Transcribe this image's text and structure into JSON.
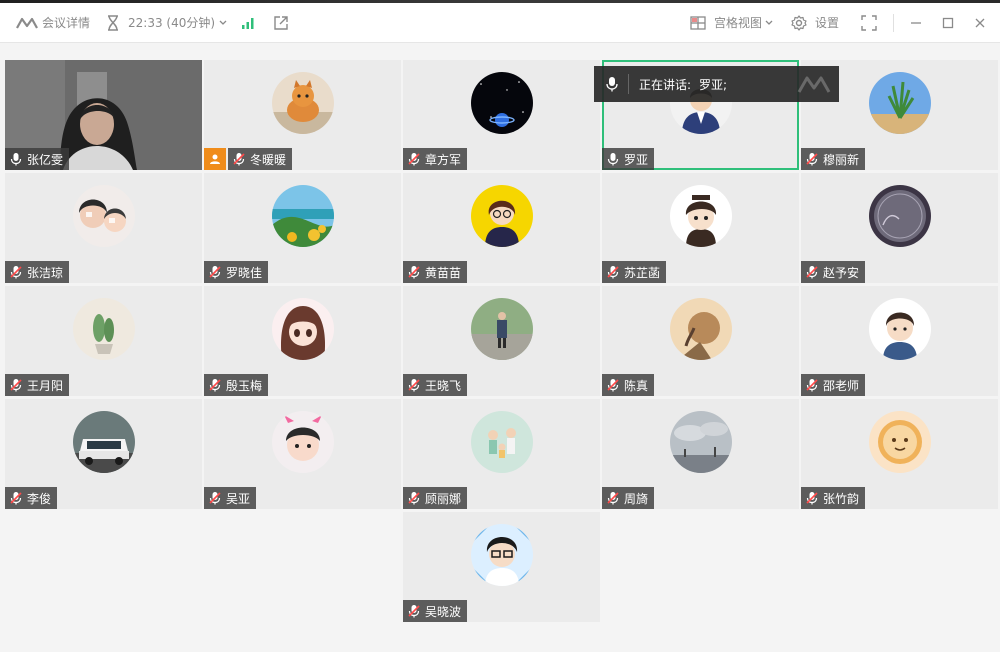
{
  "titlebar": {
    "meeting_details": "会议详情",
    "timer": "22:33 (40分钟)",
    "gallery_view": "宫格视图",
    "settings": "设置",
    "colors": {
      "signal": "#2fbf7a",
      "icon": "#8a8a8a"
    }
  },
  "speaking": {
    "label": "正在讲话:",
    "name": "罗亚;"
  },
  "participants": [
    {
      "name": "张亿雯",
      "mic": "on",
      "kind": "video"
    },
    {
      "name": "冬暖暖",
      "mic": "muted",
      "host": true,
      "avatar": "orange-cat"
    },
    {
      "name": "章方军",
      "mic": "muted",
      "avatar": "space-planet"
    },
    {
      "name": "罗亚",
      "mic": "on",
      "active": true,
      "avatar": "cartoon-boy-suit"
    },
    {
      "name": "穆丽新",
      "mic": "muted",
      "avatar": "plant-sky"
    },
    {
      "name": "张洁琼",
      "mic": "muted",
      "avatar": "mother-child-photo"
    },
    {
      "name": "罗晓佳",
      "mic": "muted",
      "avatar": "coast-landscape"
    },
    {
      "name": "黄苗苗",
      "mic": "muted",
      "avatar": "cartoon-girl-yellow"
    },
    {
      "name": "苏芷菡",
      "mic": "muted",
      "avatar": "cartoon-kid-cap"
    },
    {
      "name": "赵予安",
      "mic": "muted",
      "avatar": "coin-16"
    },
    {
      "name": "王月阳",
      "mic": "muted",
      "avatar": "cactus"
    },
    {
      "name": "殷玉梅",
      "mic": "muted",
      "avatar": "anime-girl"
    },
    {
      "name": "王晓飞",
      "mic": "muted",
      "avatar": "child-outdoor"
    },
    {
      "name": "陈真",
      "mic": "muted",
      "avatar": "sisyphus-rock"
    },
    {
      "name": "邵老师",
      "mic": "muted",
      "avatar": "cartoon-man-beard"
    },
    {
      "name": "李俊",
      "mic": "muted",
      "avatar": "white-suv"
    },
    {
      "name": "吴亚",
      "mic": "muted",
      "avatar": "kid-face"
    },
    {
      "name": "顾丽娜",
      "mic": "muted",
      "avatar": "family-illustration"
    },
    {
      "name": "周旖",
      "mic": "muted",
      "avatar": "cloudy-sky"
    },
    {
      "name": "张竹韵",
      "mic": "muted",
      "avatar": "cookie-face"
    },
    {
      "name": "吴晓波",
      "mic": "muted",
      "avatar": "glasses-man-cartoon"
    }
  ]
}
